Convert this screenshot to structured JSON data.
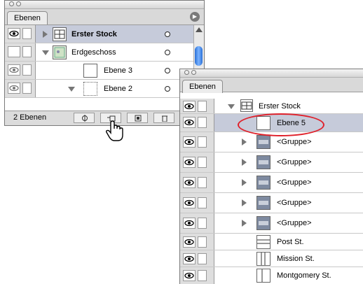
{
  "panel_a": {
    "tab_label": "Ebenen",
    "layers": [
      {
        "label": "Erster Stock",
        "expanded": false,
        "selected": true
      },
      {
        "label": "Erdgeschoss",
        "expanded": true,
        "selected": false
      },
      {
        "label": "Ebene 3",
        "expanded": false,
        "selected": false
      },
      {
        "label": "Ebene 2",
        "expanded": true,
        "selected": false
      }
    ],
    "layer_count": "2 Ebenen"
  },
  "panel_b": {
    "tab_label": "Ebenen",
    "layers": [
      {
        "label": "Erster Stock"
      },
      {
        "label": "Ebene 5"
      },
      {
        "label": "<Gruppe>"
      },
      {
        "label": "<Gruppe>"
      },
      {
        "label": "<Gruppe>"
      },
      {
        "label": "<Gruppe>"
      },
      {
        "label": "<Gruppe>"
      },
      {
        "label": "Post St."
      },
      {
        "label": "Mission St."
      },
      {
        "label": "Montgomery St."
      }
    ]
  },
  "colors": {
    "selection": "#c6cbda",
    "highlight_circle": "#e0202a",
    "scroll_thumb": "#2a6fd6"
  }
}
